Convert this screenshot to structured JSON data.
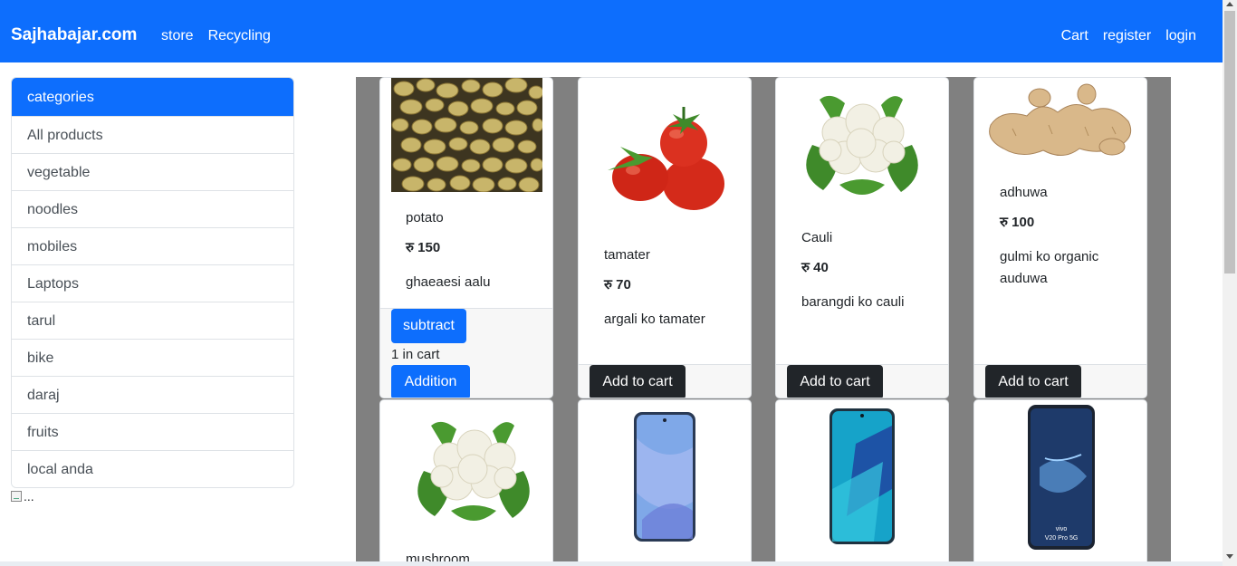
{
  "navbar": {
    "brand": "Sajhabajar.com",
    "left_links": [
      "store",
      "Recycling"
    ],
    "right_links": [
      "Cart",
      "register",
      "login"
    ]
  },
  "sidebar": {
    "header": "categories",
    "items": [
      "All products",
      "vegetable",
      "noodles",
      "mobiles",
      "Laptops",
      "tarul",
      "bike",
      "daraj",
      "fruits",
      "local anda"
    ],
    "broken_image_alt": "..."
  },
  "products": [
    {
      "name": "potato",
      "price": "रु 150",
      "description": "ghaeaesi aalu",
      "in_cart_text": "1 in cart",
      "subtract_label": "subtract",
      "addition_label": "Addition"
    },
    {
      "name": "tamater",
      "price": "रु 70",
      "description": "argali ko tamater",
      "button_label": "Add to cart"
    },
    {
      "name": "Cauli",
      "price": "रु 40",
      "description": "barangdi ko cauli",
      "button_label": "Add to cart"
    },
    {
      "name": "adhuwa",
      "price": "रु 100",
      "description": "gulmi ko organic auduwa",
      "button_label": "Add to cart"
    },
    {
      "name": "mushroom"
    },
    {},
    {},
    {}
  ],
  "colors": {
    "primary": "#0d6efd",
    "dark_button": "#212529",
    "grid_background": "#808080"
  }
}
